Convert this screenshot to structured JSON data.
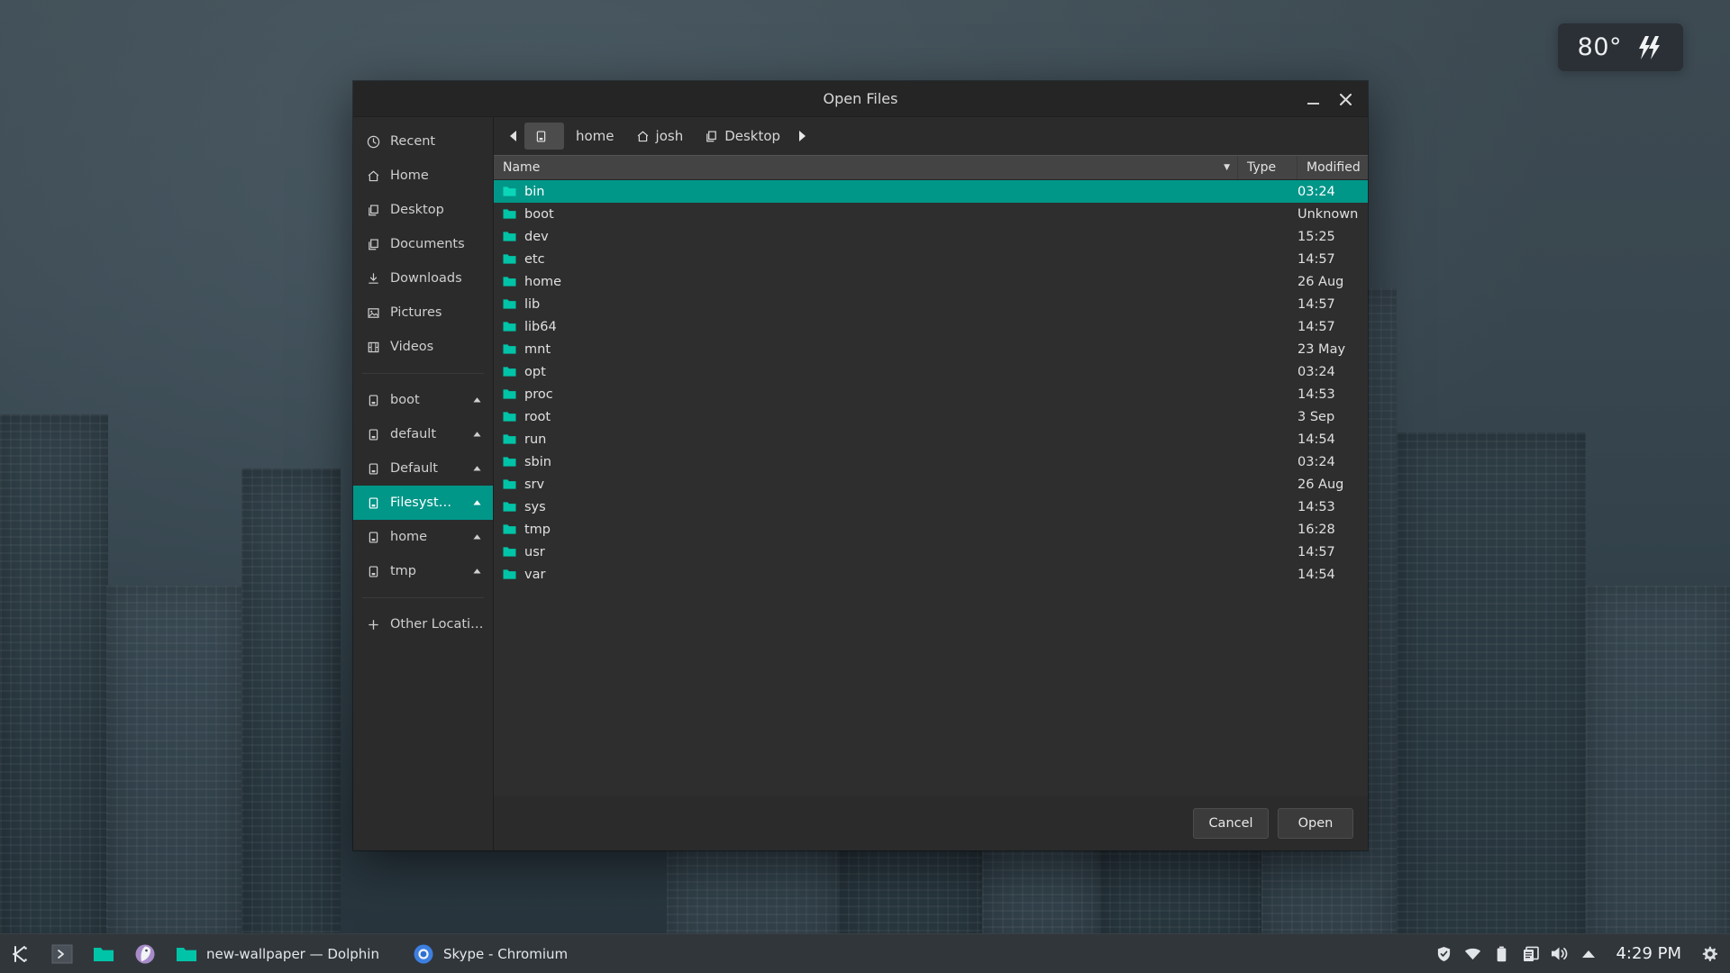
{
  "desktop": {
    "weather": {
      "temperature": "80°",
      "icon": "lightning-bolt-icon",
      "bolts": "⚡⚡"
    }
  },
  "dialog": {
    "title": "Open Files",
    "window_controls": {
      "minimize": "—",
      "close": "✕"
    },
    "sidebar": {
      "places": [
        {
          "label": "Recent",
          "icon": "clock-icon"
        },
        {
          "label": "Home",
          "icon": "home-icon"
        },
        {
          "label": "Desktop",
          "icon": "document-icon"
        },
        {
          "label": "Documents",
          "icon": "document-icon"
        },
        {
          "label": "Downloads",
          "icon": "download-icon"
        },
        {
          "label": "Pictures",
          "icon": "image-icon"
        },
        {
          "label": "Videos",
          "icon": "film-icon"
        }
      ],
      "devices": [
        {
          "label": "boot",
          "icon": "drive-icon",
          "eject": true,
          "active": false
        },
        {
          "label": "default",
          "icon": "drive-icon",
          "eject": true,
          "active": false
        },
        {
          "label": "Default",
          "icon": "drive-icon",
          "eject": true,
          "active": false
        },
        {
          "label": "Filesyste…",
          "icon": "drive-icon",
          "eject": true,
          "active": true
        },
        {
          "label": "home",
          "icon": "drive-icon",
          "eject": true,
          "active": false
        },
        {
          "label": "tmp",
          "icon": "drive-icon",
          "eject": true,
          "active": false
        }
      ],
      "other_locations": {
        "label": "Other Locations",
        "icon": "plus-icon"
      }
    },
    "pathbar": {
      "back_arrow": "◀",
      "forward_arrow": "▶",
      "crumbs": [
        {
          "label": "",
          "icon": "drive-icon",
          "current": true
        },
        {
          "label": "home",
          "icon": "",
          "current": false
        },
        {
          "label": "josh",
          "icon": "home-icon",
          "current": false
        },
        {
          "label": "Desktop",
          "icon": "document-icon",
          "current": false
        }
      ]
    },
    "columns": {
      "name": "Name",
      "type": "Type",
      "modified": "Modified",
      "sort_indicator": "▼"
    },
    "files": [
      {
        "name": "bin",
        "type": "",
        "modified": "03:24",
        "selected": true
      },
      {
        "name": "boot",
        "type": "",
        "modified": "Unknown",
        "selected": false
      },
      {
        "name": "dev",
        "type": "",
        "modified": "15:25",
        "selected": false
      },
      {
        "name": "etc",
        "type": "",
        "modified": "14:57",
        "selected": false
      },
      {
        "name": "home",
        "type": "",
        "modified": "26 Aug",
        "selected": false
      },
      {
        "name": "lib",
        "type": "",
        "modified": "14:57",
        "selected": false
      },
      {
        "name": "lib64",
        "type": "",
        "modified": "14:57",
        "selected": false
      },
      {
        "name": "mnt",
        "type": "",
        "modified": "23 May",
        "selected": false
      },
      {
        "name": "opt",
        "type": "",
        "modified": "03:24",
        "selected": false
      },
      {
        "name": "proc",
        "type": "",
        "modified": "14:53",
        "selected": false
      },
      {
        "name": "root",
        "type": "",
        "modified": "3 Sep",
        "selected": false
      },
      {
        "name": "run",
        "type": "",
        "modified": "14:54",
        "selected": false
      },
      {
        "name": "sbin",
        "type": "",
        "modified": "03:24",
        "selected": false
      },
      {
        "name": "srv",
        "type": "",
        "modified": "26 Aug",
        "selected": false
      },
      {
        "name": "sys",
        "type": "",
        "modified": "14:53",
        "selected": false
      },
      {
        "name": "tmp",
        "type": "",
        "modified": "16:28",
        "selected": false
      },
      {
        "name": "usr",
        "type": "",
        "modified": "14:57",
        "selected": false
      },
      {
        "name": "var",
        "type": "",
        "modified": "14:54",
        "selected": false
      }
    ],
    "footer": {
      "cancel": "Cancel",
      "open": "Open"
    }
  },
  "taskbar": {
    "launchers": [
      {
        "name": "kde-menu-icon"
      },
      {
        "name": "terminal-icon"
      },
      {
        "name": "file-manager-icon"
      },
      {
        "name": "browser-icon"
      }
    ],
    "tasks": [
      {
        "label": "new-wallpaper — Dolphin",
        "icon": "folder-icon"
      },
      {
        "label": "Skype - Chromium",
        "icon": "chromium-icon"
      }
    ],
    "tray": [
      {
        "name": "shield-icon"
      },
      {
        "name": "wifi-icon"
      },
      {
        "name": "battery-icon"
      },
      {
        "name": "clipboard-icon"
      },
      {
        "name": "volume-icon"
      },
      {
        "name": "chevron-up-icon"
      }
    ],
    "clock": "4:29 PM",
    "settings_icon": "gear-icon"
  },
  "colors": {
    "accent_teal": "#009688",
    "folder_teal": "#00c4a7",
    "dialog_bg": "#2b2b2b",
    "list_bg": "#2e2e2e",
    "taskbar_bg": "#31363b"
  }
}
